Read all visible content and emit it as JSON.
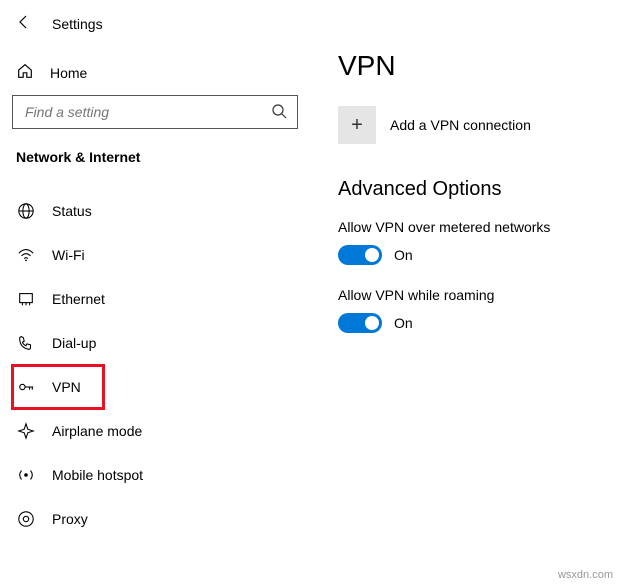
{
  "header": {
    "title": "Settings"
  },
  "home": {
    "label": "Home"
  },
  "search": {
    "placeholder": "Find a setting"
  },
  "section": {
    "label": "Network & Internet"
  },
  "nav": {
    "status": {
      "label": "Status"
    },
    "wifi": {
      "label": "Wi-Fi"
    },
    "ethernet": {
      "label": "Ethernet"
    },
    "dialup": {
      "label": "Dial-up"
    },
    "vpn": {
      "label": "VPN"
    },
    "airplane": {
      "label": "Airplane mode"
    },
    "hotspot": {
      "label": "Mobile hotspot"
    },
    "proxy": {
      "label": "Proxy"
    }
  },
  "page": {
    "title": "VPN",
    "add_label": "Add a VPN connection",
    "advanced_heading": "Advanced Options",
    "opt_metered": {
      "label": "Allow VPN over metered networks",
      "state": "On"
    },
    "opt_roaming": {
      "label": "Allow VPN while roaming",
      "state": "On"
    }
  },
  "watermark": "wsxdn.com"
}
